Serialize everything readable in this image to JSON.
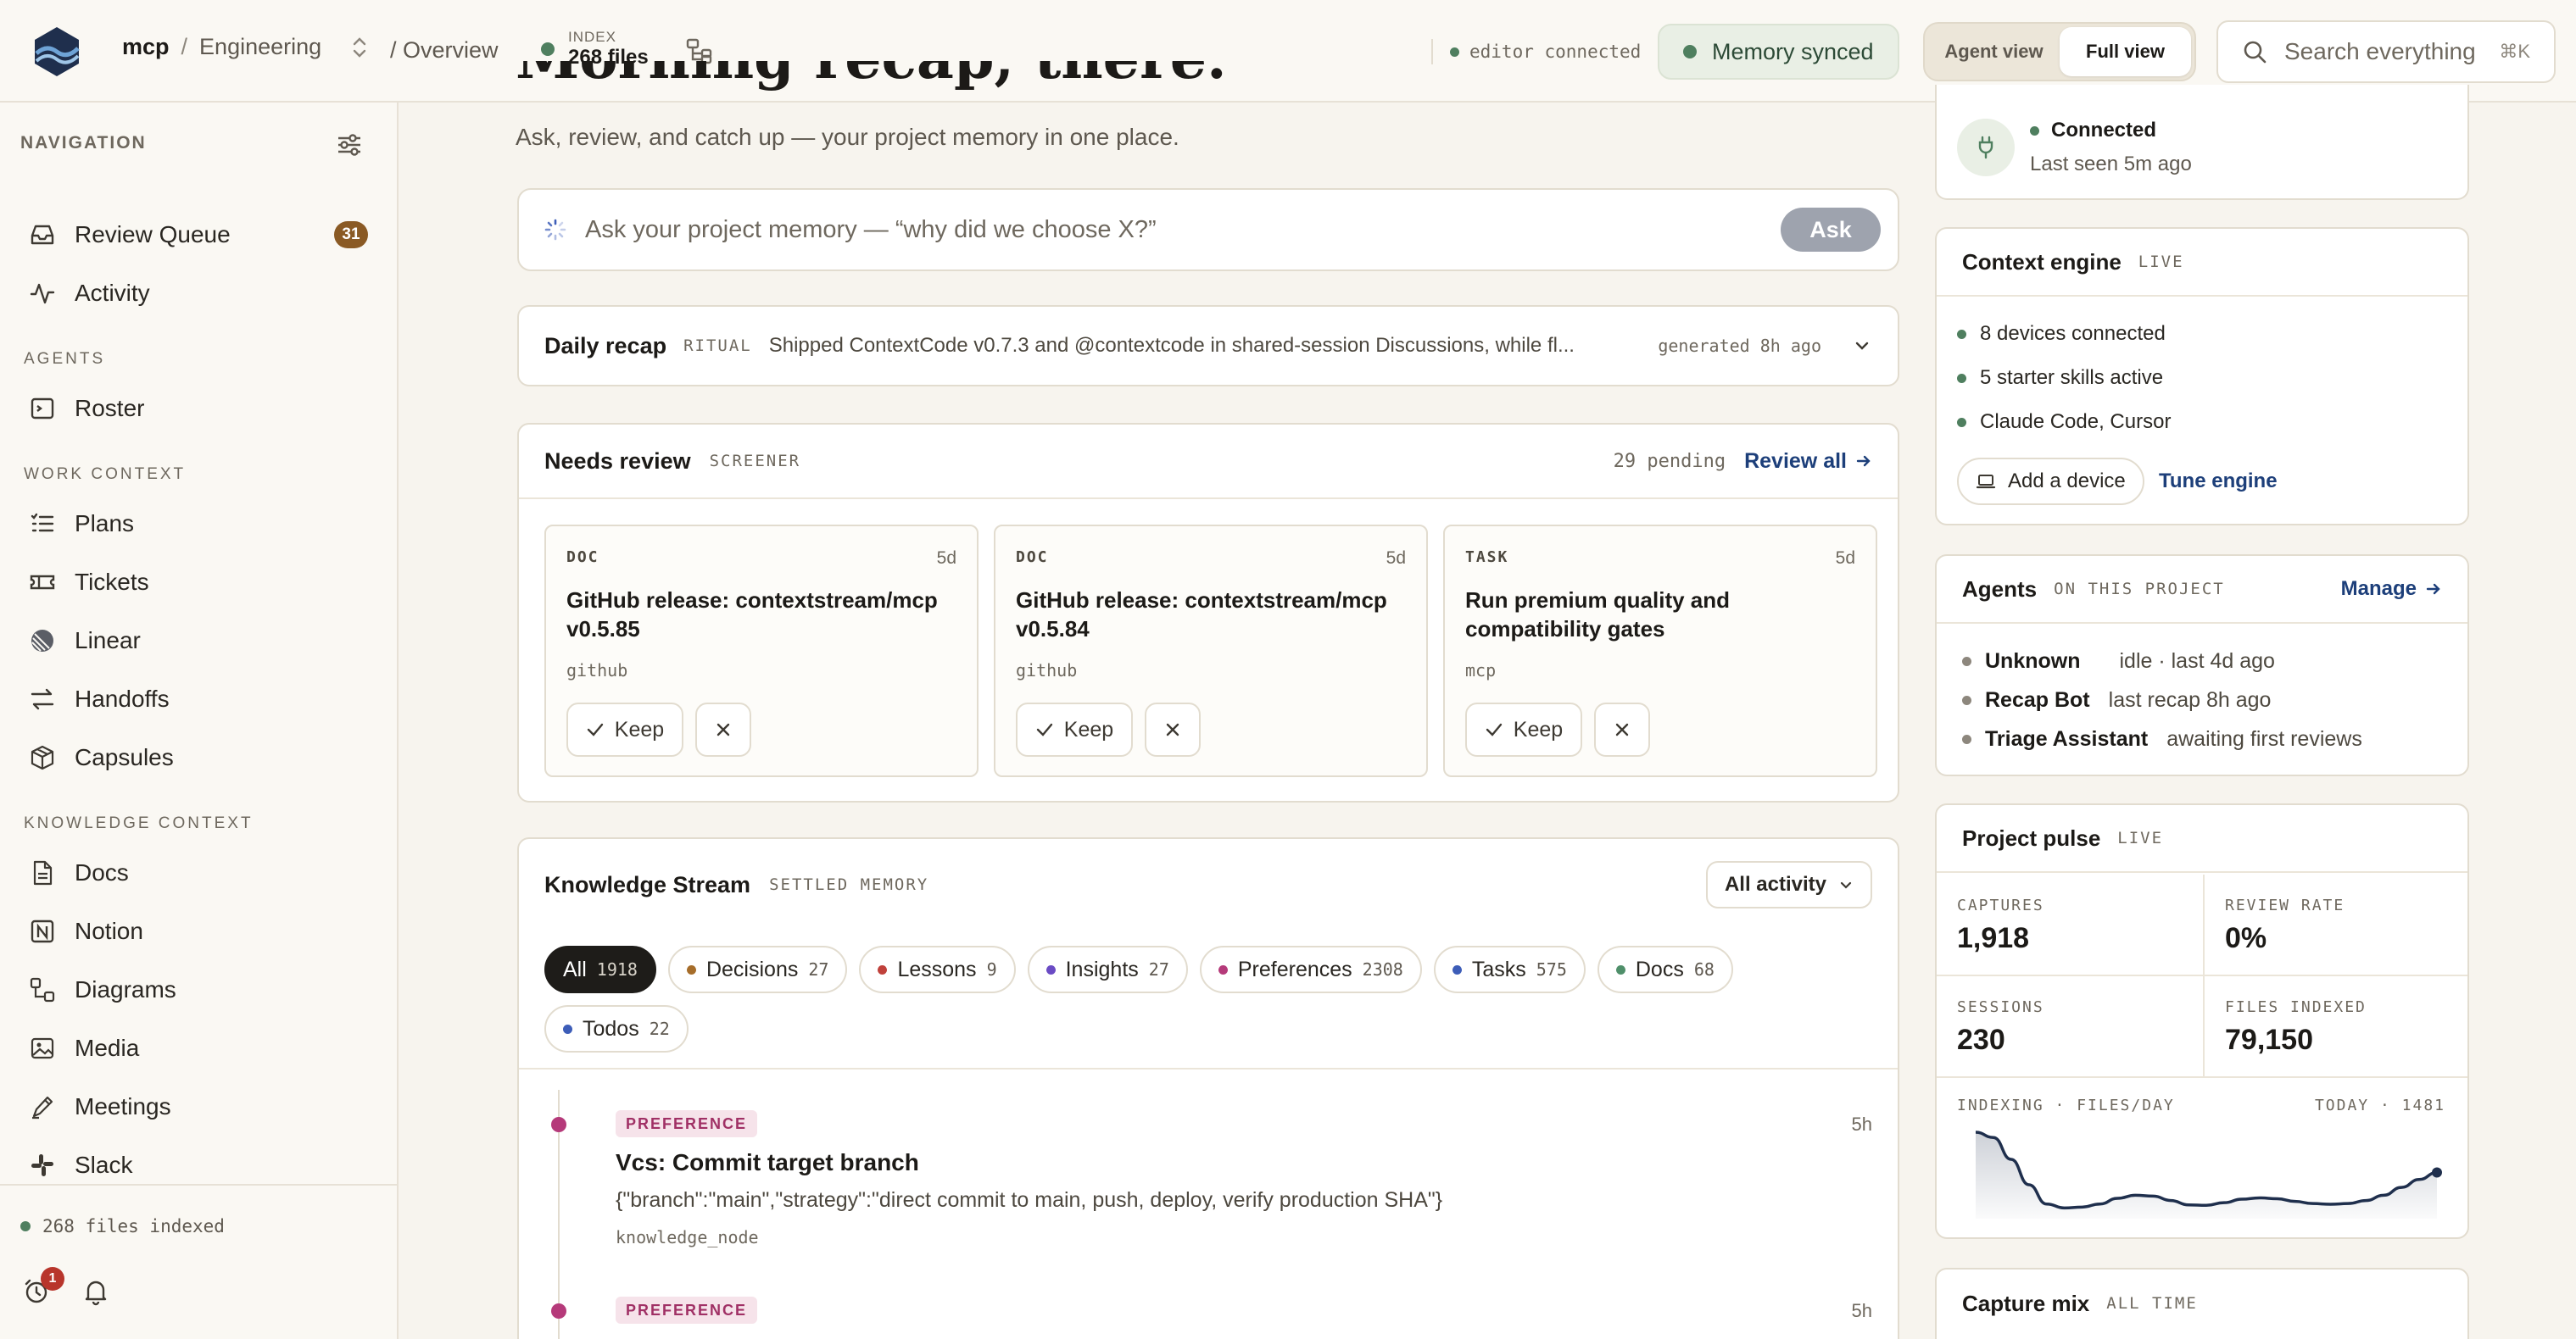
{
  "header": {
    "org": "mcp",
    "workspace": "Engineering",
    "crumb_sep": "/",
    "overview": "Overview",
    "index_label": "INDEX",
    "index_value": "268 files",
    "editor_status": "editor connected",
    "memory_status": "Memory synced",
    "view_agent": "Agent view",
    "view_full": "Full view",
    "search_placeholder": "Search everything",
    "search_shortcut": "⌘K"
  },
  "sidebar": {
    "heading": "NAVIGATION",
    "top_items": [
      {
        "label": "Review Queue",
        "icon": "inbox-icon",
        "badge": "31"
      },
      {
        "label": "Activity",
        "icon": "activity-icon"
      }
    ],
    "sections": [
      {
        "title": "AGENTS",
        "items": [
          {
            "label": "Roster",
            "icon": "terminal-icon"
          }
        ]
      },
      {
        "title": "WORK CONTEXT",
        "items": [
          {
            "label": "Plans",
            "icon": "list-check-icon"
          },
          {
            "label": "Tickets",
            "icon": "ticket-icon"
          },
          {
            "label": "Linear",
            "icon": "linear-icon"
          },
          {
            "label": "Handoffs",
            "icon": "arrows-swap-icon"
          },
          {
            "label": "Capsules",
            "icon": "box-icon"
          }
        ]
      },
      {
        "title": "KNOWLEDGE CONTEXT",
        "items": [
          {
            "label": "Docs",
            "icon": "document-icon"
          },
          {
            "label": "Notion",
            "icon": "notion-icon"
          },
          {
            "label": "Diagrams",
            "icon": "diagram-icon"
          },
          {
            "label": "Media",
            "icon": "image-icon"
          },
          {
            "label": "Meetings",
            "icon": "pen-icon"
          },
          {
            "label": "Slack",
            "icon": "slack-icon"
          }
        ]
      }
    ],
    "footer_status": "268 files indexed",
    "alarm_badge": "1"
  },
  "hero": {
    "title": "Morning recap, there.",
    "subtitle": "Ask, review, and catch up — your project memory in one place."
  },
  "ask": {
    "placeholder": "Ask your project memory — “why did we choose X?”",
    "button": "Ask"
  },
  "recap": {
    "title": "Daily recap",
    "tag": "RITUAL",
    "text": "Shipped ContextCode v0.7.3 and @contextcode in shared-session Discussions, while fl...",
    "generated": "generated 8h ago"
  },
  "review": {
    "title": "Needs review",
    "tag": "SCREENER",
    "pending": "29 pending",
    "review_all": "Review all",
    "keep_label": "Keep",
    "cards": [
      {
        "type": "DOC",
        "age": "5d",
        "title": "GitHub release: contextstream/mcp v0.5.85",
        "source": "github"
      },
      {
        "type": "DOC",
        "age": "5d",
        "title": "GitHub release: contextstream/mcp v0.5.84",
        "source": "github"
      },
      {
        "type": "TASK",
        "age": "5d",
        "title": "Run premium quality and compatibility gates",
        "source": "mcp"
      }
    ]
  },
  "stream": {
    "title": "Knowledge Stream",
    "tag": "SETTLED MEMORY",
    "filter": "All activity",
    "chips": [
      {
        "label": "All",
        "count": "1918",
        "color": "",
        "active": true
      },
      {
        "label": "Decisions",
        "count": "27",
        "color": "#a66d2a"
      },
      {
        "label": "Lessons",
        "count": "9",
        "color": "#c0413b"
      },
      {
        "label": "Insights",
        "count": "27",
        "color": "#6a4bc4"
      },
      {
        "label": "Preferences",
        "count": "2308",
        "color": "#b53a7a"
      },
      {
        "label": "Tasks",
        "count": "575",
        "color": "#3d5db8"
      },
      {
        "label": "Docs",
        "count": "68",
        "color": "#4f8f6a"
      },
      {
        "label": "Todos",
        "count": "22",
        "color": "#3d5db8"
      }
    ],
    "entries": [
      {
        "tag": "PREFERENCE",
        "age": "5h",
        "title": "Vcs: Commit target branch",
        "body": "{\"branch\":\"main\",\"strategy\":\"direct commit to main, push, deploy, verify production SHA\"}",
        "source": "knowledge_node"
      },
      {
        "tag": "PREFERENCE",
        "age": "5h"
      }
    ]
  },
  "connection": {
    "state": "Connected",
    "seen": "Last seen 5m ago"
  },
  "engine": {
    "title": "Context engine",
    "tag": "LIVE",
    "bullets": [
      "8 devices connected",
      "5 starter skills active",
      "Claude Code, Cursor"
    ],
    "add_device": "Add a device",
    "tune": "Tune engine"
  },
  "agents": {
    "title": "Agents",
    "tag": "ON THIS PROJECT",
    "manage": "Manage",
    "rows": [
      {
        "name": "Unknown",
        "status": "idle · last 4d ago"
      },
      {
        "name": "Recap Bot",
        "status": "last recap 8h ago"
      },
      {
        "name": "Triage Assistant",
        "status": "awaiting first reviews"
      }
    ]
  },
  "pulse": {
    "title": "Project pulse",
    "tag": "LIVE",
    "metrics": [
      {
        "label": "CAPTURES",
        "value": "1,918"
      },
      {
        "label": "REVIEW RATE",
        "value": "0%"
      },
      {
        "label": "SESSIONS",
        "value": "230"
      },
      {
        "label": "FILES INDEXED",
        "value": "79,150"
      }
    ],
    "spark_label": "INDEXING · FILES/DAY",
    "spark_today": "TODAY · 1481",
    "spark_values": [
      1820,
      1700,
      1200,
      620,
      180,
      90,
      110,
      180,
      310,
      380,
      360,
      260,
      160,
      150,
      210,
      290,
      320,
      300,
      240,
      190,
      175,
      190,
      260,
      380,
      560,
      740,
      900
    ]
  },
  "mix": {
    "title": "Capture mix",
    "tag": "ALL TIME"
  },
  "colors": {
    "accent": "#1d3f7a",
    "ok": "#4f7f5f",
    "badge": "#8a5a24",
    "preference": "#b53a7a"
  }
}
